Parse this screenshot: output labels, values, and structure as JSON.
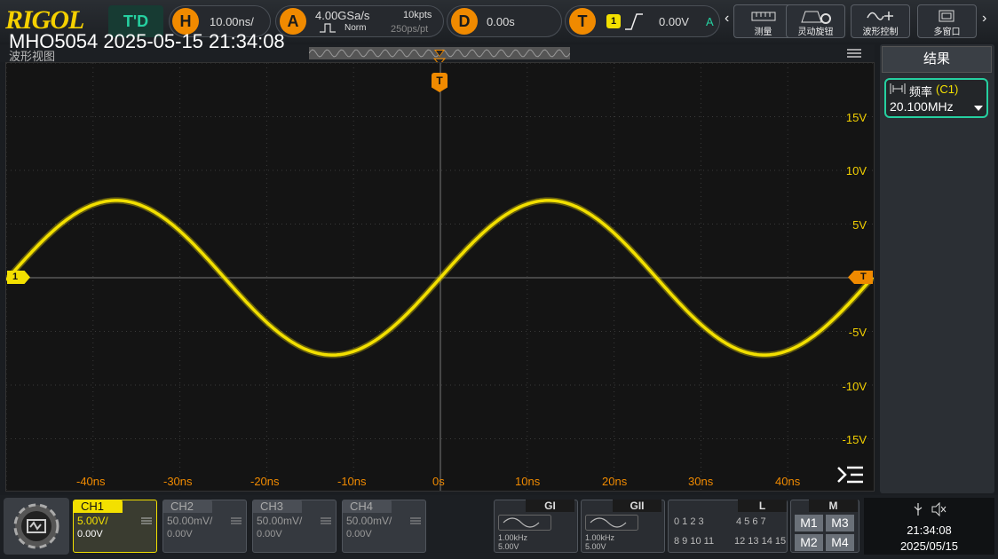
{
  "brand": "RIGOL",
  "overlay_title": "MHO5054 2025-05-15 21:34:08",
  "top": {
    "run_state": "T'D",
    "horizontal": {
      "badge": "H",
      "timebase": "10.00ns/"
    },
    "acquire": {
      "badge": "A",
      "sample_rate": "4.00GSa/s",
      "memory": "10kpts",
      "mode": "Norm",
      "resolution": "250ps/pt"
    },
    "delay": {
      "badge": "D",
      "value": "0.00s"
    },
    "trigger": {
      "badge": "T",
      "channel": "1",
      "level": "0.00V",
      "mode": "A"
    },
    "buttons": [
      {
        "label": "测量",
        "icon": "ruler-icon"
      },
      {
        "label": "灵动旋钮",
        "icon": "knob-icon"
      },
      {
        "label": "波形控制",
        "icon": "wave-control-icon"
      },
      {
        "label": "多窗口",
        "icon": "windows-icon"
      }
    ]
  },
  "waveform_view": {
    "title": "波形视图",
    "y_labels": [
      "15V",
      "10V",
      "5V",
      "-5V",
      "-10V",
      "-15V"
    ],
    "x_labels": [
      "-40ns",
      "-30ns",
      "-20ns",
      "-10ns",
      "0s",
      "10ns",
      "20ns",
      "30ns",
      "40ns"
    ],
    "trigger_marker": "T",
    "channel_marker": "1",
    "trigger_level_marker": "T",
    "signal": {
      "amplitude_v": 7.2,
      "period_ns": 49.75,
      "color": "#f3e000"
    }
  },
  "results_panel": {
    "title": "结果",
    "measure_label": "频率",
    "measure_channel": "(C1)",
    "measure_value": "20.100MHz"
  },
  "channels": [
    {
      "name": "CH1",
      "scale": "5.00V/",
      "offset": "0.00V",
      "active": true
    },
    {
      "name": "CH2",
      "scale": "50.00mV/",
      "offset": "0.00V",
      "active": false
    },
    {
      "name": "CH3",
      "scale": "50.00mV/",
      "offset": "0.00V",
      "active": false
    },
    {
      "name": "CH4",
      "scale": "50.00mV/",
      "offset": "0.00V",
      "active": false
    }
  ],
  "generators": [
    {
      "name": "GI",
      "freq": "1.00kHz",
      "amp": "5.00V"
    },
    {
      "name": "GII",
      "freq": "1.00kHz",
      "amp": "5.00V"
    }
  ],
  "logic": {
    "title": "L",
    "row1a": "0 1 2 3",
    "row1b": "4 5 6 7",
    "row2a": "8 9 10 11",
    "row2b": "12 13 14 15"
  },
  "math": {
    "title": "M",
    "items": [
      "M1",
      "M3",
      "M2",
      "M4"
    ]
  },
  "status": {
    "time": "21:34:08",
    "date": "2025/05/15"
  },
  "colors": {
    "ch1": "#f3e000",
    "accent_orange": "#f08a00",
    "teal": "#25d0a0"
  }
}
